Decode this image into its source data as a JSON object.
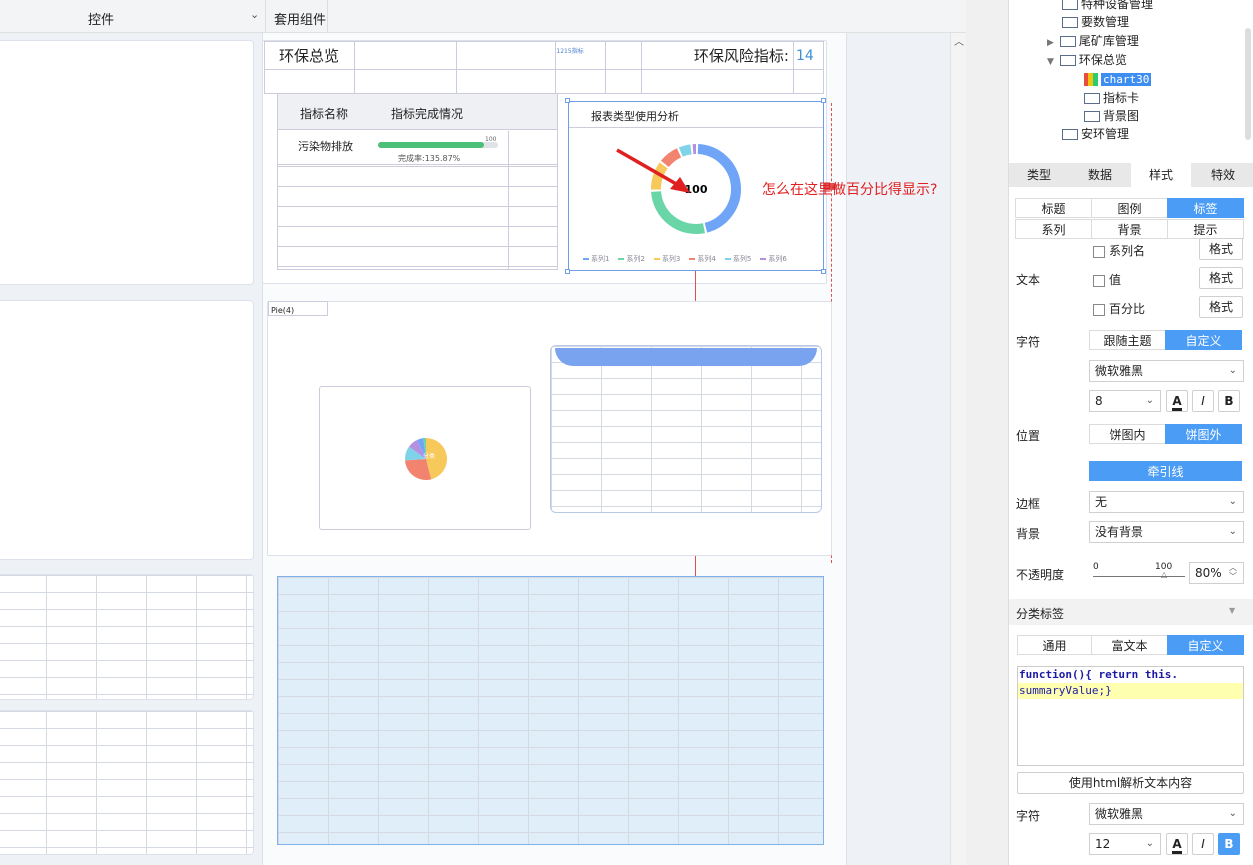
{
  "toolbar": {
    "controls_label": "控件",
    "components_label": "套用组件"
  },
  "canvas": {
    "env_overview_title": "环保总览",
    "env_risk_label": "环保风险指标:",
    "env_risk_value": "14",
    "top_small_text": "1215指标",
    "indicator_table": {
      "col_name": "指标名称",
      "col_completion": "指标完成情况",
      "row1_name": "污染物排放",
      "row1_percent": "100",
      "row1_note": "完成率:135.87%"
    },
    "chart": {
      "title": "报表类型使用分析",
      "center_value": "100",
      "legend": [
        "系列1",
        "系列2",
        "系列3",
        "系列4",
        "系列5",
        "系列6"
      ]
    },
    "annotation": "怎么在这里做百分比得显示?",
    "mid_tag": "Pie(4)",
    "pie_mini_label": "分类"
  },
  "chart_data": {
    "type": "pie",
    "title": "报表类型使用分析",
    "categories": [
      "系列1",
      "系列2",
      "系列3",
      "系列4",
      "系列5",
      "系列6"
    ],
    "values": [
      46,
      28,
      11,
      8,
      5,
      2
    ]
  },
  "tree": {
    "items": [
      {
        "label": "特种设备管理"
      },
      {
        "label": "要数管理"
      },
      {
        "label": "尾矿库管理"
      },
      {
        "label": "环保总览"
      },
      {
        "label": "chart30"
      },
      {
        "label": "指标卡"
      },
      {
        "label": "背景图"
      },
      {
        "label": "安环管理"
      }
    ]
  },
  "panel": {
    "main_tabs": [
      "类型",
      "数据",
      "样式",
      "特效"
    ],
    "sub_tabs": [
      "标题",
      "图例",
      "标签",
      "系列",
      "背景",
      "提示"
    ],
    "text_label": "文本",
    "series_name": "系列名",
    "value": "值",
    "percent": "百分比",
    "format_btn": "格式",
    "font_label": "字符",
    "follow_theme": "跟随主题",
    "custom": "自定义",
    "font_family": "微软雅黑",
    "font_size": "8",
    "position_label": "位置",
    "inside_pie": "饼图内",
    "outside_pie": "饼图外",
    "leader_line": "牵引线",
    "border_label": "边框",
    "border_value": "无",
    "background_label": "背景",
    "background_value": "没有背景",
    "opacity_label": "不透明度",
    "opacity_min": "0",
    "opacity_max": "100",
    "opacity_value": "80%",
    "category_label_section": "分类标签",
    "general": "通用",
    "rich_text": "富文本",
    "code_line1_kw": "function",
    "code_line1_rest": "(){ return this.",
    "code_line2": "summaryValue;}",
    "html_parse_btn": "使用html解析文本内容",
    "font2_label": "字符",
    "font2_family": "微软雅黑",
    "font2_size": "12",
    "italic": "I",
    "bold": "B"
  },
  "colors": {
    "accent": "#4a9cf5",
    "annotation_red": "#e02020",
    "pie": [
      "#6fa4f7",
      "#6ad6a8",
      "#f7c85a",
      "#f2846f",
      "#7fd3e8",
      "#b391e0"
    ]
  }
}
